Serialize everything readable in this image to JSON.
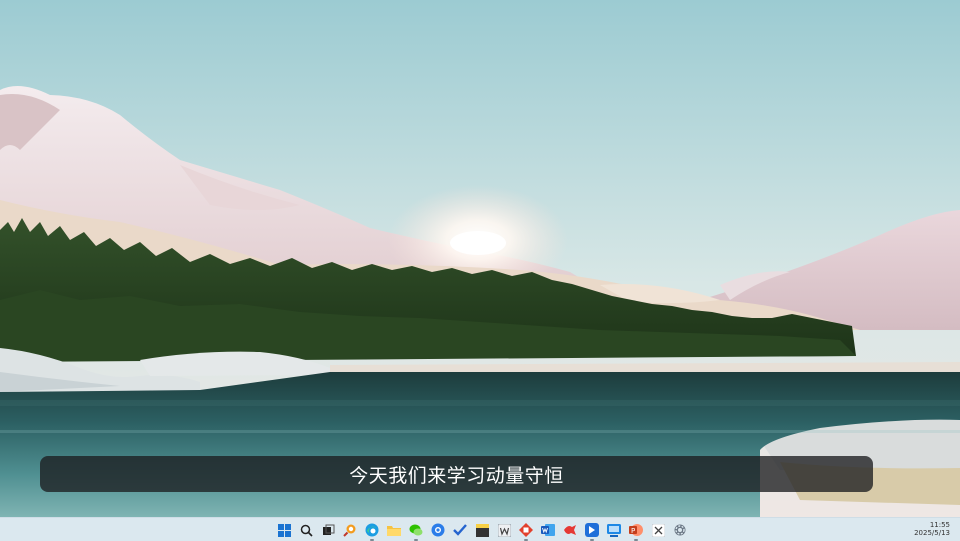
{
  "caption": {
    "text": "今天我们来学习动量守恒"
  },
  "taskbar": {
    "icons": [
      {
        "name": "start-icon"
      },
      {
        "name": "search-icon"
      },
      {
        "name": "task-view-icon"
      },
      {
        "name": "search-app-icon"
      },
      {
        "name": "edge-icon"
      },
      {
        "name": "file-explorer-icon"
      },
      {
        "name": "wechat-icon"
      },
      {
        "name": "browser-icon"
      },
      {
        "name": "todo-icon"
      },
      {
        "name": "sticky-notes-icon"
      },
      {
        "name": "wps-icon"
      },
      {
        "name": "word-icon"
      },
      {
        "name": "xmind-icon"
      },
      {
        "name": "kingsoft-icon"
      },
      {
        "name": "feishu-icon"
      },
      {
        "name": "remote-desktop-icon"
      },
      {
        "name": "powerpoint-icon"
      },
      {
        "name": "excel-icon"
      },
      {
        "name": "settings-icon"
      }
    ],
    "clock": {
      "time": "11:55",
      "date": "2025/5/13"
    }
  }
}
